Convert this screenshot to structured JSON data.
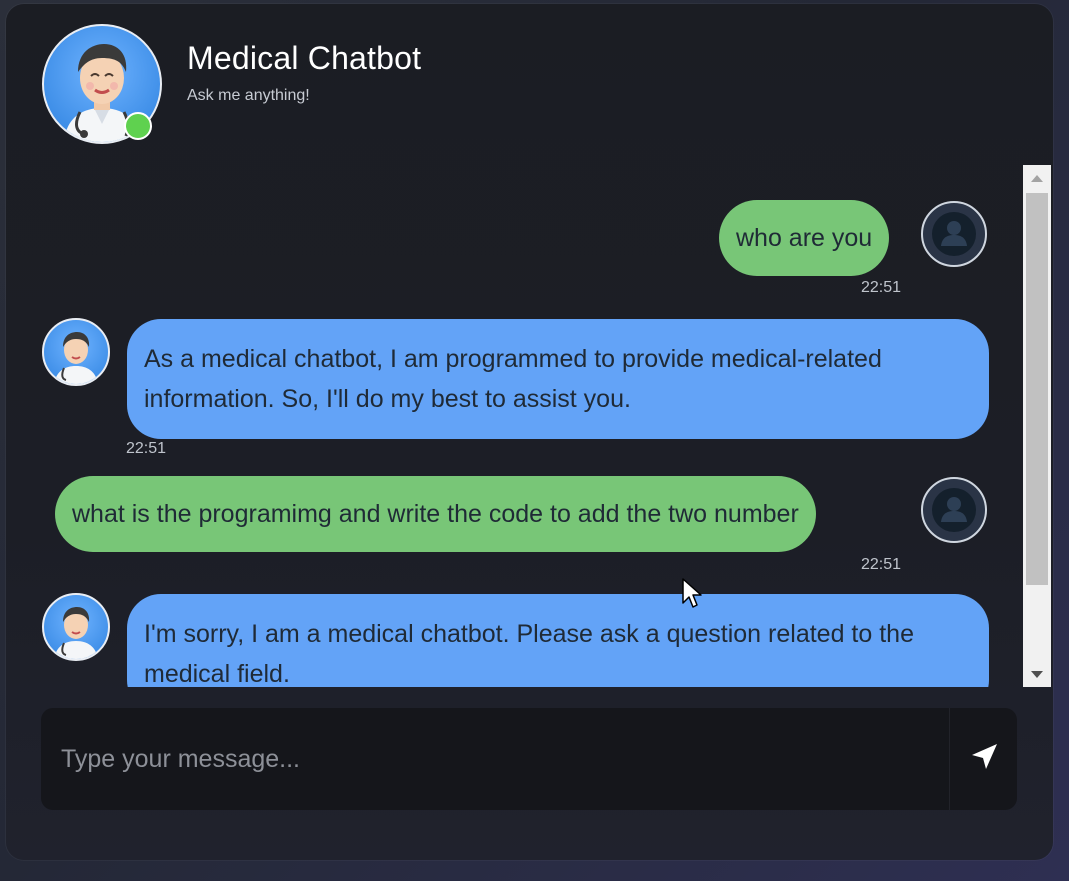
{
  "header": {
    "title": "Medical Chatbot",
    "subtitle": "Ask me anything!",
    "status": "online"
  },
  "messages": [
    {
      "role": "user",
      "text": "who are you",
      "time": "22:51"
    },
    {
      "role": "bot",
      "text": "As a medical chatbot, I am programmed to provide medical-related information. So, I'll do my best to assist you.",
      "time": "22:51"
    },
    {
      "role": "user",
      "text": "what is the programimg and write the code to add the two number",
      "time": "22:51"
    },
    {
      "role": "bot",
      "text": "I'm sorry, I am a medical chatbot. Please ask a question related to the medical field.",
      "time": ""
    }
  ],
  "input": {
    "placeholder": "Type your message...",
    "value": ""
  },
  "icons": {
    "send": "send-arrow-icon",
    "user_avatar": "user-icon",
    "bot_avatar": "doctor-icon"
  },
  "colors": {
    "user_bubble": "#78c677",
    "bot_bubble": "#63a3f7",
    "online": "#5fd14f"
  }
}
